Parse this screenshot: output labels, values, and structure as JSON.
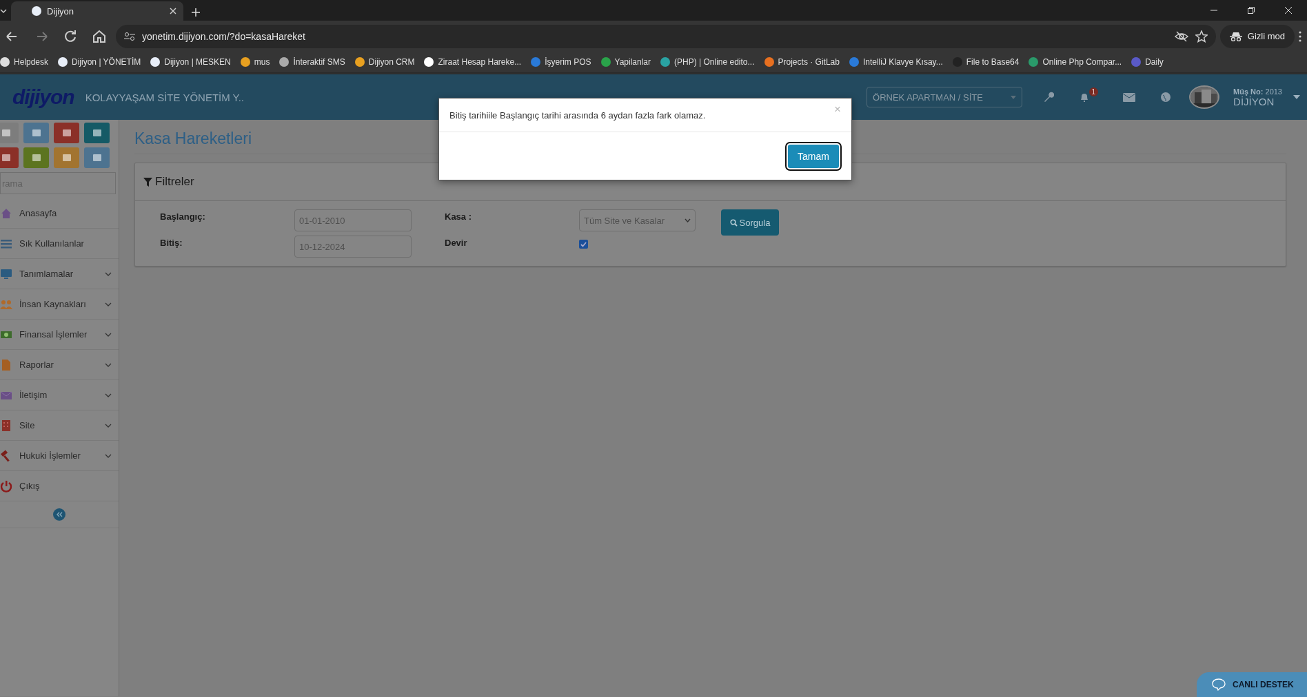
{
  "browser": {
    "tabs": [
      {
        "title": "Dijiyon",
        "selected": true
      }
    ],
    "url": "yonetim.dijiyon.com/?do=kasaHareket",
    "profile": "Gizli mod",
    "bookmarks": [
      {
        "label": "Helpdesk"
      },
      {
        "label": "Dijiyon | YÖNETİM"
      },
      {
        "label": "Dijiyon | MESKEN"
      },
      {
        "label": "mus"
      },
      {
        "label": "İnteraktif SMS"
      },
      {
        "label": "Dijiyon CRM"
      },
      {
        "label": "Ziraat Hesap Hareke..."
      },
      {
        "label": "İşyerim POS"
      },
      {
        "label": "Yapilanlar"
      },
      {
        "label": "(PHP) | Online edito..."
      },
      {
        "label": "Projects · GitLab"
      },
      {
        "label": "IntelliJ  Klavye Kısay..."
      },
      {
        "label": "File to Base64"
      },
      {
        "label": "Online Php Compar..."
      },
      {
        "label": "Daily"
      }
    ]
  },
  "header": {
    "logo": "dijiyon",
    "site_name": "KOLAYYAŞAM SİTE YÖNETİM Y..",
    "site_select": "ÖRNEK APARTMAN / SİTE",
    "notification_count": "1",
    "customer_label": "Müş No:",
    "customer_no": "2013",
    "user": "DİJİYON"
  },
  "sidebar": {
    "tiles": [
      {
        "color": "#7d7d7d"
      },
      {
        "color": "#4d7390"
      },
      {
        "color": "#8b3028"
      },
      {
        "color": "#155a66"
      },
      {
        "color": "#8b3028"
      },
      {
        "color": "#5c7420"
      },
      {
        "color": "#a27430"
      },
      {
        "color": "#4d7390"
      }
    ],
    "search": {
      "placeholder": "rama"
    },
    "items": [
      {
        "label": "Anasayfa",
        "kind": "link"
      },
      {
        "label": "Sık Kullanılanlar",
        "kind": "link"
      },
      {
        "label": "Tanımlamalar",
        "kind": "group"
      },
      {
        "label": "İnsan Kaynakları",
        "kind": "group"
      },
      {
        "label": "Finansal İşlemler",
        "kind": "group"
      },
      {
        "label": "Raporlar",
        "kind": "group"
      },
      {
        "label": "İletişim",
        "kind": "group"
      },
      {
        "label": "Site",
        "kind": "group"
      },
      {
        "label": "Hukuki İşlemler",
        "kind": "group"
      },
      {
        "label": "Çıkış",
        "kind": "link"
      }
    ]
  },
  "page": {
    "title": "Kasa Hareketleri",
    "filters": {
      "title": "Filtreler",
      "start_label": "Başlangıç:",
      "start_value": "01-01-2010",
      "end_label": "Bitiş:",
      "end_value": "10-12-2024",
      "kasa_label": "Kasa :",
      "kasa_value": "Tüm Site ve Kasalar",
      "devir_label": "Devir",
      "devir_checked": true,
      "query_button": "Sorgula"
    }
  },
  "dialog": {
    "message": "Bitiş tarihiile Başlangıç tarihi arasında 6 aydan fazla fark olamaz.",
    "close": "×",
    "ok_button": "Tamam"
  },
  "chat_button": "CANLI DESTEK"
}
